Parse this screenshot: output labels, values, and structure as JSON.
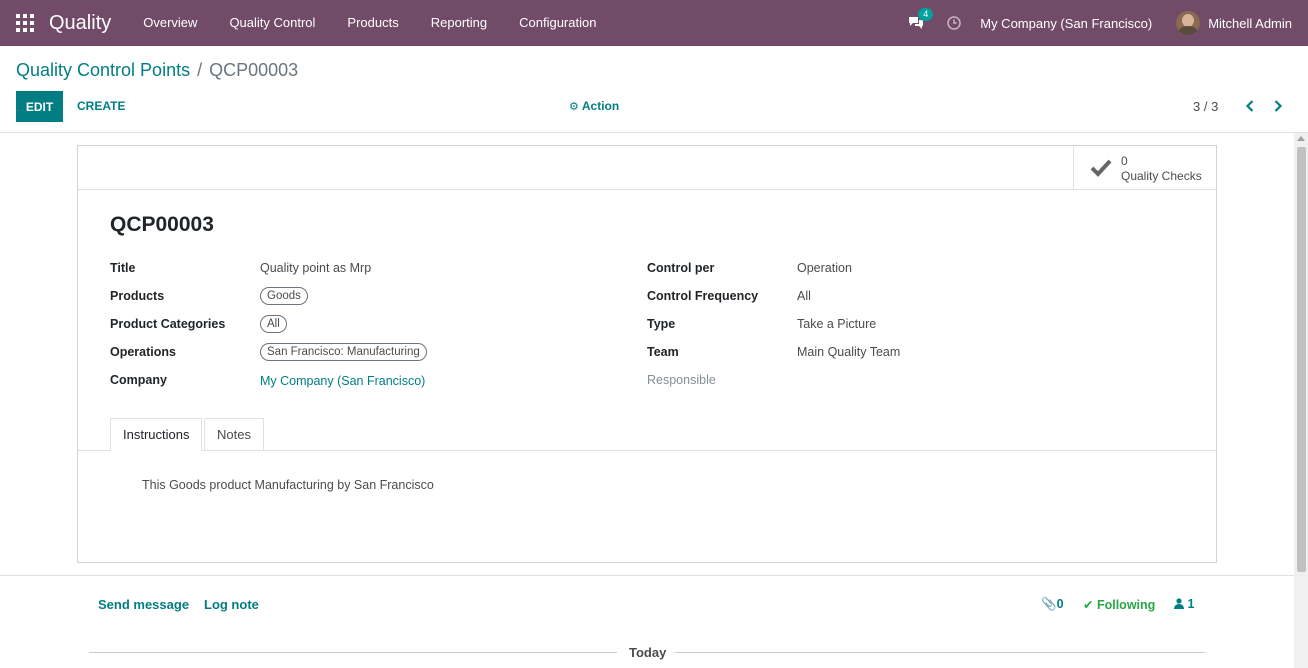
{
  "navbar": {
    "app_name": "Quality",
    "menu": [
      "Overview",
      "Quality Control",
      "Products",
      "Reporting",
      "Configuration"
    ],
    "messages_count": "4",
    "company": "My Company (San Francisco)",
    "user": "Mitchell Admin"
  },
  "control_panel": {
    "breadcrumb_parent": "Quality Control Points",
    "breadcrumb_sep": "/",
    "breadcrumb_current": "QCP00003",
    "edit_label": "EDIT",
    "create_label": "CREATE",
    "action_label": "Action",
    "pager": "3 / 3"
  },
  "smart_button": {
    "count": "0",
    "label": "Quality Checks"
  },
  "record": {
    "name": "QCP00003",
    "left_fields": [
      {
        "label": "Title",
        "value": "Quality point as Mrp"
      },
      {
        "label": "Products",
        "value": "Goods"
      },
      {
        "label": "Product Categories",
        "value": "All"
      },
      {
        "label": "Operations",
        "value": "San Francisco: Manufacturing"
      },
      {
        "label": "Company",
        "value": "My Company (San Francisco)"
      }
    ],
    "right_fields": [
      {
        "label": "Control per",
        "value": "Operation"
      },
      {
        "label": "Control Frequency",
        "value": "All"
      },
      {
        "label": "Type",
        "value": "Take a Picture"
      },
      {
        "label": "Team",
        "value": "Main Quality Team"
      },
      {
        "label": "Responsible",
        "value": ""
      }
    ]
  },
  "tabs": [
    "Instructions",
    "Notes"
  ],
  "instructions_text": "This Goods product Manufacturing by San Francisco",
  "chatter": {
    "send_message": "Send message",
    "log_note": "Log note",
    "attachments": "0",
    "following": "Following",
    "followers": "1",
    "today": "Today"
  },
  "colors": {
    "navbar": "#714b67",
    "primary": "#017e84",
    "follow_green": "#28a745"
  }
}
